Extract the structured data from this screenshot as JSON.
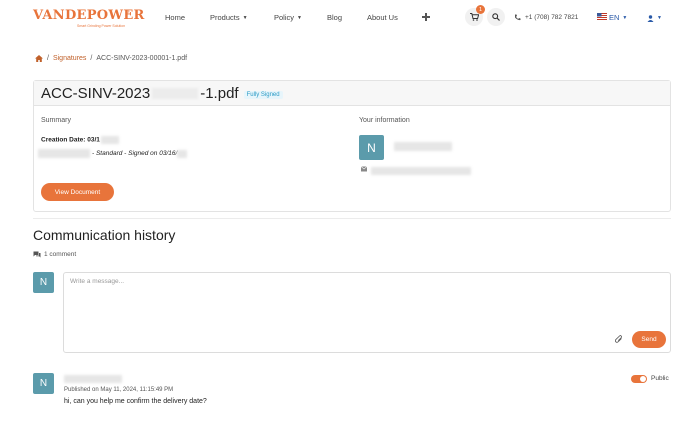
{
  "brand": {
    "logo": "VANDEPOWER",
    "tagline": "Smart Grinding Power Solution",
    "registered": "®",
    "accent": "#e8743b"
  },
  "nav": {
    "items": [
      {
        "label": "Home",
        "dropdown": false
      },
      {
        "label": "Products",
        "dropdown": true
      },
      {
        "label": "Policy",
        "dropdown": true
      },
      {
        "label": "Blog",
        "dropdown": false
      },
      {
        "label": "About Us",
        "dropdown": false
      }
    ],
    "plus_icon": "plus-icon",
    "cart_count": "1",
    "phone": "+1 (708) 782 7821",
    "language": "EN",
    "user_icon": "user-icon"
  },
  "breadcrumb": {
    "home_icon": "home-icon",
    "section": "Signatures",
    "current": "ACC-SINV-2023-00001-1.pdf"
  },
  "document": {
    "title_prefix": "ACC-SINV-2023",
    "title_suffix": "-1.pdf",
    "status": "Fully Signed",
    "summary_label": "Summary",
    "creation_label": "Creation Date: 03/1",
    "signed_line": "- Standard - Signed on 03/16/",
    "view_button": "View Document",
    "your_info_label": "Your information",
    "avatar_letter": "N"
  },
  "communication": {
    "title": "Communication history",
    "comment_count": "1 comment",
    "avatar_letter": "N",
    "placeholder": "Write a message...",
    "send_label": "Send",
    "comment": {
      "avatar_letter": "N",
      "published": "Published on May 11, 2024, 11:15:49 PM",
      "text": "hi, can you help me confirm the delivery date?",
      "visibility": "Public"
    }
  }
}
